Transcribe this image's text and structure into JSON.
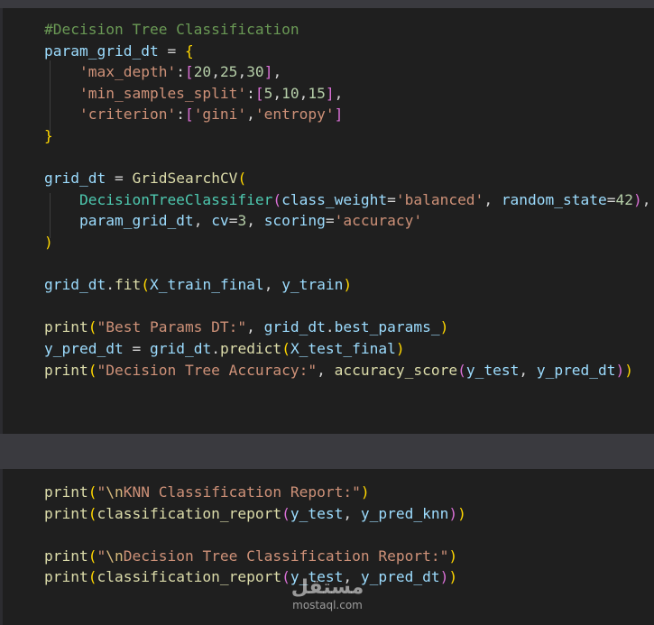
{
  "cell1": {
    "lines": [
      [
        {
          "t": "#Decision Tree Classification",
          "c": "comment"
        }
      ],
      [
        {
          "t": "param_grid_dt",
          "c": "var"
        },
        {
          "t": " = ",
          "c": "op"
        },
        {
          "t": "{",
          "c": "b1"
        }
      ],
      [
        {
          "t": "    ",
          "c": "op"
        },
        {
          "t": "'max_depth'",
          "c": "str"
        },
        {
          "t": ":",
          "c": "op"
        },
        {
          "t": "[",
          "c": "b2"
        },
        {
          "t": "20",
          "c": "num"
        },
        {
          "t": ",",
          "c": "op"
        },
        {
          "t": "25",
          "c": "num"
        },
        {
          "t": ",",
          "c": "op"
        },
        {
          "t": "30",
          "c": "num"
        },
        {
          "t": "]",
          "c": "b2"
        },
        {
          "t": ",",
          "c": "op"
        }
      ],
      [
        {
          "t": "    ",
          "c": "op"
        },
        {
          "t": "'min_samples_split'",
          "c": "str"
        },
        {
          "t": ":",
          "c": "op"
        },
        {
          "t": "[",
          "c": "b2"
        },
        {
          "t": "5",
          "c": "num"
        },
        {
          "t": ",",
          "c": "op"
        },
        {
          "t": "10",
          "c": "num"
        },
        {
          "t": ",",
          "c": "op"
        },
        {
          "t": "15",
          "c": "num"
        },
        {
          "t": "]",
          "c": "b2"
        },
        {
          "t": ",",
          "c": "op"
        }
      ],
      [
        {
          "t": "    ",
          "c": "op"
        },
        {
          "t": "'criterion'",
          "c": "str"
        },
        {
          "t": ":",
          "c": "op"
        },
        {
          "t": "[",
          "c": "b2"
        },
        {
          "t": "'gini'",
          "c": "str"
        },
        {
          "t": ",",
          "c": "op"
        },
        {
          "t": "'entropy'",
          "c": "str"
        },
        {
          "t": "]",
          "c": "b2"
        }
      ],
      [
        {
          "t": "}",
          "c": "b1"
        }
      ],
      [],
      [
        {
          "t": "grid_dt",
          "c": "var"
        },
        {
          "t": " = ",
          "c": "op"
        },
        {
          "t": "GridSearchCV",
          "c": "fn"
        },
        {
          "t": "(",
          "c": "b1"
        }
      ],
      [
        {
          "t": "    ",
          "c": "op"
        },
        {
          "t": "DecisionTreeClassifier",
          "c": "cls"
        },
        {
          "t": "(",
          "c": "b2"
        },
        {
          "t": "class_weight",
          "c": "var"
        },
        {
          "t": "=",
          "c": "op"
        },
        {
          "t": "'balanced'",
          "c": "str"
        },
        {
          "t": ", ",
          "c": "op"
        },
        {
          "t": "random_state",
          "c": "var"
        },
        {
          "t": "=",
          "c": "op"
        },
        {
          "t": "42",
          "c": "num"
        },
        {
          "t": ")",
          "c": "b2"
        },
        {
          "t": ",",
          "c": "op"
        }
      ],
      [
        {
          "t": "    ",
          "c": "op"
        },
        {
          "t": "param_grid_dt",
          "c": "var"
        },
        {
          "t": ", ",
          "c": "op"
        },
        {
          "t": "cv",
          "c": "var"
        },
        {
          "t": "=",
          "c": "op"
        },
        {
          "t": "3",
          "c": "num"
        },
        {
          "t": ", ",
          "c": "op"
        },
        {
          "t": "scoring",
          "c": "var"
        },
        {
          "t": "=",
          "c": "op"
        },
        {
          "t": "'accuracy'",
          "c": "str"
        }
      ],
      [
        {
          "t": ")",
          "c": "b1"
        }
      ],
      [],
      [
        {
          "t": "grid_dt",
          "c": "var"
        },
        {
          "t": ".",
          "c": "op"
        },
        {
          "t": "fit",
          "c": "fn"
        },
        {
          "t": "(",
          "c": "b1"
        },
        {
          "t": "X_train_final",
          "c": "var"
        },
        {
          "t": ", ",
          "c": "op"
        },
        {
          "t": "y_train",
          "c": "var"
        },
        {
          "t": ")",
          "c": "b1"
        }
      ],
      [],
      [
        {
          "t": "print",
          "c": "fn"
        },
        {
          "t": "(",
          "c": "b1"
        },
        {
          "t": "\"Best Params DT:\"",
          "c": "str"
        },
        {
          "t": ", ",
          "c": "op"
        },
        {
          "t": "grid_dt",
          "c": "var"
        },
        {
          "t": ".",
          "c": "op"
        },
        {
          "t": "best_params_",
          "c": "var"
        },
        {
          "t": ")",
          "c": "b1"
        }
      ],
      [
        {
          "t": "y_pred_dt",
          "c": "var"
        },
        {
          "t": " = ",
          "c": "op"
        },
        {
          "t": "grid_dt",
          "c": "var"
        },
        {
          "t": ".",
          "c": "op"
        },
        {
          "t": "predict",
          "c": "fn"
        },
        {
          "t": "(",
          "c": "b1"
        },
        {
          "t": "X_test_final",
          "c": "var"
        },
        {
          "t": ")",
          "c": "b1"
        }
      ],
      [
        {
          "t": "print",
          "c": "fn"
        },
        {
          "t": "(",
          "c": "b1"
        },
        {
          "t": "\"Decision Tree Accuracy:\"",
          "c": "str"
        },
        {
          "t": ", ",
          "c": "op"
        },
        {
          "t": "accuracy_score",
          "c": "fn"
        },
        {
          "t": "(",
          "c": "b2"
        },
        {
          "t": "y_test",
          "c": "var"
        },
        {
          "t": ", ",
          "c": "op"
        },
        {
          "t": "y_pred_dt",
          "c": "var"
        },
        {
          "t": ")",
          "c": "b2"
        },
        {
          "t": ")",
          "c": "b1"
        }
      ]
    ]
  },
  "cell2": {
    "lines": [
      [
        {
          "t": "print",
          "c": "fn"
        },
        {
          "t": "(",
          "c": "b1"
        },
        {
          "t": "\"",
          "c": "str"
        },
        {
          "t": "\\n",
          "c": "esc"
        },
        {
          "t": "KNN Classification Report:\"",
          "c": "str"
        },
        {
          "t": ")",
          "c": "b1"
        }
      ],
      [
        {
          "t": "print",
          "c": "fn"
        },
        {
          "t": "(",
          "c": "b1"
        },
        {
          "t": "classification_report",
          "c": "fn"
        },
        {
          "t": "(",
          "c": "b2"
        },
        {
          "t": "y_test",
          "c": "var"
        },
        {
          "t": ", ",
          "c": "op"
        },
        {
          "t": "y_pred_knn",
          "c": "var"
        },
        {
          "t": ")",
          "c": "b2"
        },
        {
          "t": ")",
          "c": "b1"
        }
      ],
      [],
      [
        {
          "t": "print",
          "c": "fn"
        },
        {
          "t": "(",
          "c": "b1"
        },
        {
          "t": "\"",
          "c": "str"
        },
        {
          "t": "\\n",
          "c": "esc"
        },
        {
          "t": "Decision Tree Classification Report:\"",
          "c": "str"
        },
        {
          "t": ")",
          "c": "b1"
        }
      ],
      [
        {
          "t": "print",
          "c": "fn"
        },
        {
          "t": "(",
          "c": "b1"
        },
        {
          "t": "classification_report",
          "c": "fn"
        },
        {
          "t": "(",
          "c": "b2"
        },
        {
          "t": "y_test",
          "c": "var"
        },
        {
          "t": ", ",
          "c": "op"
        },
        {
          "t": "y_pred_dt",
          "c": "var"
        },
        {
          "t": ")",
          "c": "b2"
        },
        {
          "t": ")",
          "c": "b1"
        }
      ]
    ]
  },
  "watermark": {
    "logo": "مستقل",
    "url": "mostaql.com"
  }
}
